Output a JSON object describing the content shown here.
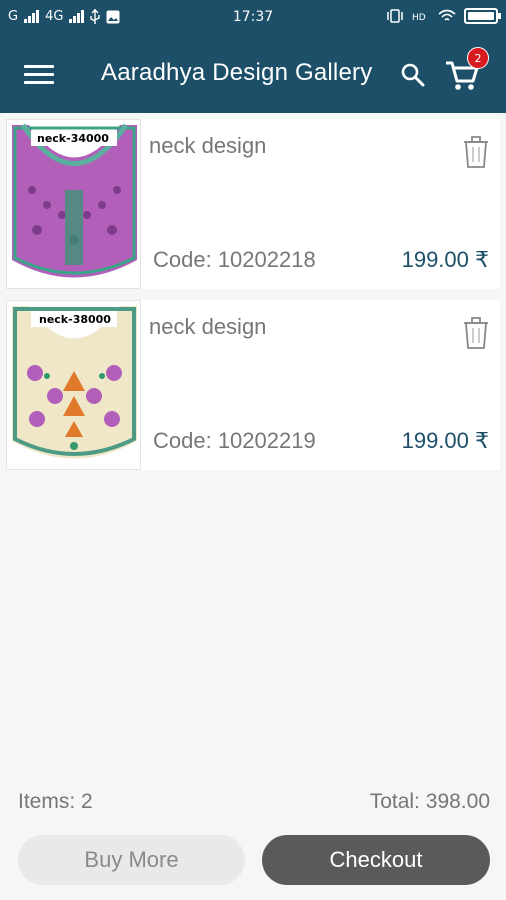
{
  "status_bar": {
    "network_left": "G",
    "network_4g": "4G",
    "time": "17:37"
  },
  "app_bar": {
    "title": "Aaradhya Design Gallery",
    "cart_count": "2",
    "icons": [
      "menu-icon",
      "search-icon",
      "cart-icon"
    ]
  },
  "cart": {
    "items": [
      {
        "name": "neck design",
        "code": "Code: 10202218",
        "price": "199.00 ₹",
        "image_label": "neck-34000"
      },
      {
        "name": "neck design",
        "code": "Code: 10202219",
        "price": "199.00 ₹",
        "image_label": "neck-38000"
      }
    ]
  },
  "summary": {
    "items": "Items: 2",
    "total": "Total: 398.00"
  },
  "buttons": {
    "buy_more": "Buy More",
    "checkout": "Checkout"
  },
  "colors": {
    "primary": "#1d5068",
    "badge": "#d71920",
    "checkout_bg": "#5a5a5a",
    "buymore_bg": "#e9e9e9"
  }
}
